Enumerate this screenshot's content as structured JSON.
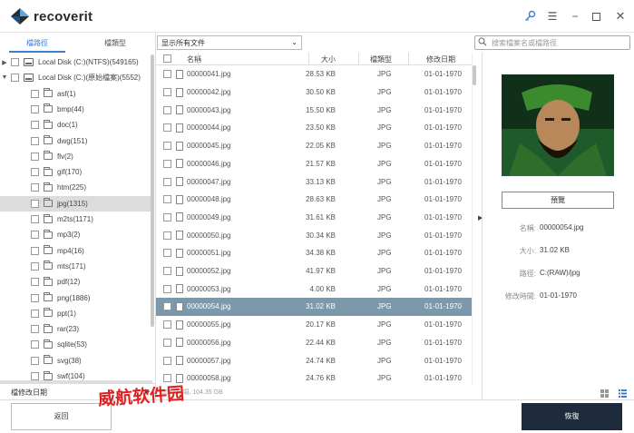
{
  "app": {
    "title": "recoverit",
    "brand_color": "#2a2a2a",
    "accent": "#3b7fd1"
  },
  "window": {
    "icons": [
      "key-icon",
      "menu-icon",
      "minimize-icon",
      "maximize-icon",
      "close-icon"
    ]
  },
  "left": {
    "tabs": [
      "檔路徑",
      "檔類型"
    ],
    "tree": [
      {
        "label": "Local Disk (C:)(NTFS)(549165)",
        "level": 0,
        "arrow": "▶",
        "kind": "disk"
      },
      {
        "label": "Local Disk (C:)(原始檔案)(5552)",
        "level": 0,
        "arrow": "▼",
        "kind": "disk"
      },
      {
        "label": "asf(1)",
        "level": 1
      },
      {
        "label": "bmp(44)",
        "level": 1
      },
      {
        "label": "doc(1)",
        "level": 1
      },
      {
        "label": "dwg(151)",
        "level": 1
      },
      {
        "label": "flv(2)",
        "level": 1
      },
      {
        "label": "gif(170)",
        "level": 1
      },
      {
        "label": "htm(225)",
        "level": 1
      },
      {
        "label": "jpg(1315)",
        "level": 1,
        "selected": true
      },
      {
        "label": "m2ts(1171)",
        "level": 1
      },
      {
        "label": "mp3(2)",
        "level": 1
      },
      {
        "label": "mp4(16)",
        "level": 1
      },
      {
        "label": "mts(171)",
        "level": 1
      },
      {
        "label": "pdf(12)",
        "level": 1
      },
      {
        "label": "png(1886)",
        "level": 1
      },
      {
        "label": "ppt(1)",
        "level": 1
      },
      {
        "label": "rar(23)",
        "level": 1
      },
      {
        "label": "sqlite(53)",
        "level": 1
      },
      {
        "label": "svg(38)",
        "level": 1
      },
      {
        "label": "swf(104)",
        "level": 1
      }
    ],
    "footer_label": "檔修改日期",
    "footer_arrow": "▶"
  },
  "filter": {
    "value": "显示所有文件",
    "chevron": "⌄"
  },
  "search": {
    "placeholder": "搜索檔案名或檔路徑"
  },
  "table": {
    "headers": {
      "name": "名稱",
      "size": "大小",
      "type": "檔類型",
      "date": "修改日期"
    },
    "rows": [
      {
        "name": "00000041.jpg",
        "size": "28.53  KB",
        "type": "JPG",
        "date": "01-01-1970"
      },
      {
        "name": "00000042.jpg",
        "size": "30.50  KB",
        "type": "JPG",
        "date": "01-01-1970"
      },
      {
        "name": "00000043.jpg",
        "size": "15.50  KB",
        "type": "JPG",
        "date": "01-01-1970"
      },
      {
        "name": "00000044.jpg",
        "size": "23.50  KB",
        "type": "JPG",
        "date": "01-01-1970"
      },
      {
        "name": "00000045.jpg",
        "size": "22.05  KB",
        "type": "JPG",
        "date": "01-01-1970"
      },
      {
        "name": "00000046.jpg",
        "size": "21.57  KB",
        "type": "JPG",
        "date": "01-01-1970"
      },
      {
        "name": "00000047.jpg",
        "size": "33.13  KB",
        "type": "JPG",
        "date": "01-01-1970"
      },
      {
        "name": "00000048.jpg",
        "size": "28.63  KB",
        "type": "JPG",
        "date": "01-01-1970"
      },
      {
        "name": "00000049.jpg",
        "size": "31.61  KB",
        "type": "JPG",
        "date": "01-01-1970"
      },
      {
        "name": "00000050.jpg",
        "size": "30.34  KB",
        "type": "JPG",
        "date": "01-01-1970"
      },
      {
        "name": "00000051.jpg",
        "size": "34.38  KB",
        "type": "JPG",
        "date": "01-01-1970"
      },
      {
        "name": "00000052.jpg",
        "size": "41.97  KB",
        "type": "JPG",
        "date": "01-01-1970"
      },
      {
        "name": "00000053.jpg",
        "size": "4.00  KB",
        "type": "JPG",
        "date": "01-01-1970"
      },
      {
        "name": "00000054.jpg",
        "size": "31.02  KB",
        "type": "JPG",
        "date": "01-01-1970",
        "selected": true
      },
      {
        "name": "00000055.jpg",
        "size": "20.17  KB",
        "type": "JPG",
        "date": "01-01-1970"
      },
      {
        "name": "00000056.jpg",
        "size": "22.44  KB",
        "type": "JPG",
        "date": "01-01-1970"
      },
      {
        "name": "00000057.jpg",
        "size": "24.74  KB",
        "type": "JPG",
        "date": "01-01-1970"
      },
      {
        "name": "00000058.jpg",
        "size": "24.76  KB",
        "type": "JPG",
        "date": "01-01-1970"
      }
    ],
    "selected_color": "#7b99ab"
  },
  "status": {
    "text": "554717項, 104.35  GB"
  },
  "preview": {
    "button_label": "預覽",
    "meta": [
      {
        "label": "名稱:",
        "value": "00000054.jpg"
      },
      {
        "label": "大小:",
        "value": "31.02  KB"
      },
      {
        "label": "路徑:",
        "value": "C:(RAW)/jpg"
      },
      {
        "label": "修改時間:",
        "value": "01-01-1970"
      }
    ]
  },
  "footer": {
    "back_label": "返回",
    "recover_label": "恢復",
    "recover_color": "#1e2b3c"
  },
  "watermark": {
    "text": "威航软件园"
  }
}
